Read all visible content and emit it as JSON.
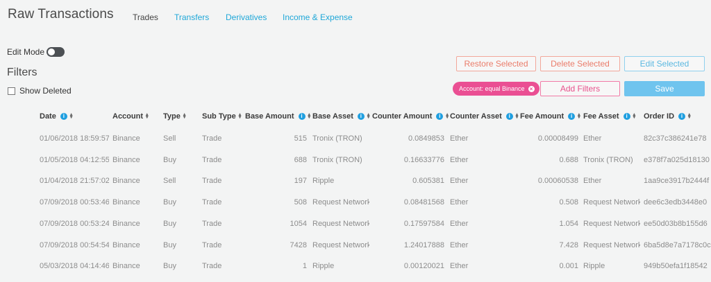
{
  "page": {
    "title": "Raw Transactions"
  },
  "nav": {
    "tabs": [
      "Trades",
      "Transfers",
      "Derivatives",
      "Income & Expense"
    ],
    "active": 0
  },
  "edit_mode": {
    "label": "Edit Mode",
    "enabled": true
  },
  "filters": {
    "title": "Filters",
    "show_deleted_label": "Show Deleted",
    "show_deleted_checked": false,
    "chip_label": "Account: equal Binance"
  },
  "actions": {
    "restore": "Restore Selected",
    "delete": "Delete Selected",
    "edit": "Edit Selected",
    "add_filters": "Add Filters",
    "save": "Save"
  },
  "colors": {
    "accent": "#1fa7d8",
    "chip": "#ea4f93",
    "danger": "#ea7c6a",
    "save": "#6fc4ee"
  },
  "table": {
    "columns": [
      "Date",
      "Account",
      "Type",
      "Sub Type",
      "Base Amount",
      "Base Asset",
      "Counter Amount",
      "Counter Asset",
      "Fee Amount",
      "Fee Asset",
      "Order ID"
    ],
    "rows": [
      [
        "01/06/2018 18:59:57",
        "Binance",
        "Sell",
        "Trade",
        "515",
        "Tronix (TRON)",
        "0.0849853",
        "Ether",
        "0.00008499",
        "Ether",
        "82c37c386241e78"
      ],
      [
        "01/05/2018 04:12:55",
        "Binance",
        "Buy",
        "Trade",
        "688",
        "Tronix (TRON)",
        "0.16633776",
        "Ether",
        "0.688",
        "Tronix (TRON)",
        "e378f7a025d18130"
      ],
      [
        "01/04/2018 21:57:02",
        "Binance",
        "Sell",
        "Trade",
        "197",
        "Ripple",
        "0.605381",
        "Ether",
        "0.00060538",
        "Ether",
        "1aa9ce3917b2444f"
      ],
      [
        "07/09/2018 00:53:46",
        "Binance",
        "Buy",
        "Trade",
        "508",
        "Request Network",
        "0.08481568",
        "Ether",
        "0.508",
        "Request Network",
        "dee6c3edb3448e0"
      ],
      [
        "07/09/2018 00:53:24",
        "Binance",
        "Buy",
        "Trade",
        "1054",
        "Request Network",
        "0.17597584",
        "Ether",
        "1.054",
        "Request Network",
        "ee50d03b8b155d6"
      ],
      [
        "07/09/2018 00:54:54",
        "Binance",
        "Buy",
        "Trade",
        "7428",
        "Request Network",
        "1.24017888",
        "Ether",
        "7.428",
        "Request Network",
        "6ba5d8e7a7178c0c"
      ],
      [
        "05/03/2018 04:14:46",
        "Binance",
        "Buy",
        "Trade",
        "1",
        "Ripple",
        "0.00120021",
        "Ether",
        "0.001",
        "Ripple",
        "949b50efa1f18542"
      ]
    ]
  }
}
